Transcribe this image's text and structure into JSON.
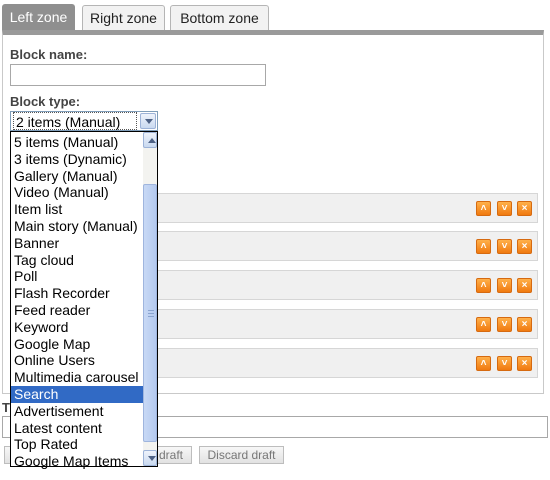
{
  "tabs": [
    {
      "label": "Left zone",
      "active": true
    },
    {
      "label": "Right zone",
      "active": false
    },
    {
      "label": "Bottom zone",
      "active": false
    }
  ],
  "form": {
    "block_name_label": "Block name:",
    "block_name_value": "",
    "block_type_label": "Block type:",
    "block_type_selected": "2 items (Manual)"
  },
  "dropdown": {
    "options": [
      "5 items (Manual)",
      "3 items (Dynamic)",
      "Gallery (Manual)",
      "Video (Manual)",
      "Item list",
      "Main story (Manual)",
      "Banner",
      "Tag cloud",
      "Poll",
      "Flash Recorder",
      "Feed reader",
      "Keyword",
      "Google Map",
      "Online Users",
      "Multimedia carousel",
      "Search",
      "Advertisement",
      "Latest content",
      "Top Rated",
      "Google Map Items"
    ],
    "highlighted": "Search"
  },
  "block_rows": {
    "count": 5,
    "actions": [
      "move-up",
      "move-down",
      "delete"
    ]
  },
  "bottom": {
    "label_partial": "T",
    "buttons": [
      "draft",
      "Discard draft"
    ]
  },
  "colors": {
    "active_tab": "#8f8f8f",
    "action_button": "#f07a10",
    "selection": "#316ac5"
  }
}
